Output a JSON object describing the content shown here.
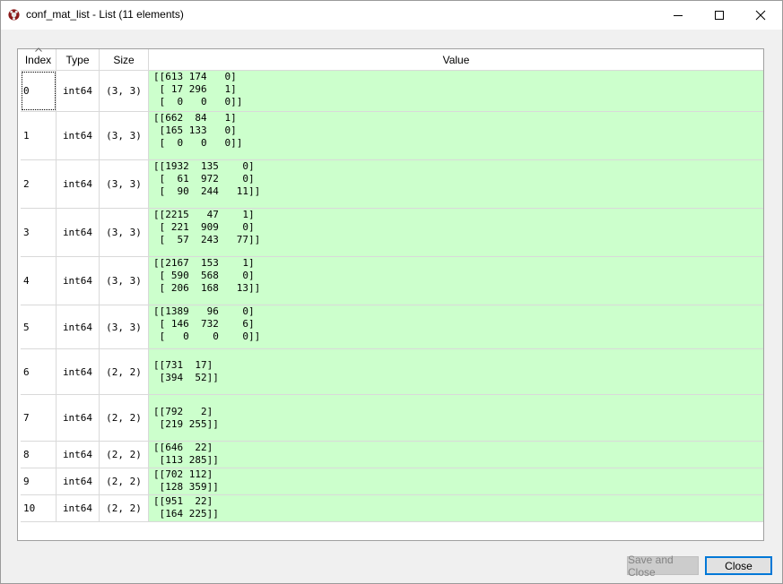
{
  "window": {
    "title": "conf_mat_list - List (11 elements)",
    "icon": "spyder-icon"
  },
  "columns": {
    "index": "Index",
    "type": "Type",
    "size": "Size",
    "value": "Value"
  },
  "rows": [
    {
      "index": "0",
      "type": "int64",
      "size": "(3, 3)",
      "value": "[[613 174   0]\n [ 17 296   1]\n [  0   0   0]]"
    },
    {
      "index": "1",
      "type": "int64",
      "size": "(3, 3)",
      "value": "[[662  84   1]\n [165 133   0]\n [  0   0   0]]"
    },
    {
      "index": "2",
      "type": "int64",
      "size": "(3, 3)",
      "value": "[[1932  135    0]\n [  61  972    0]\n [  90  244   11]]"
    },
    {
      "index": "3",
      "type": "int64",
      "size": "(3, 3)",
      "value": "[[2215   47    1]\n [ 221  909    0]\n [  57  243   77]]"
    },
    {
      "index": "4",
      "type": "int64",
      "size": "(3, 3)",
      "value": "[[2167  153    1]\n [ 590  568    0]\n [ 206  168   13]]"
    },
    {
      "index": "5",
      "type": "int64",
      "size": "(3, 3)",
      "value": "[[1389   96    0]\n [ 146  732    6]\n [   0    0    0]]"
    },
    {
      "index": "6",
      "type": "int64",
      "size": "(2, 2)",
      "value": "[[731  17]\n [394  52]]"
    },
    {
      "index": "7",
      "type": "int64",
      "size": "(2, 2)",
      "value": "[[792   2]\n [219 255]]"
    },
    {
      "index": "8",
      "type": "int64",
      "size": "(2, 2)",
      "value": "[[646  22]\n [113 285]]"
    },
    {
      "index": "9",
      "type": "int64",
      "size": "(2, 2)",
      "value": "[[702 112]\n [128 359]]"
    },
    {
      "index": "10",
      "type": "int64",
      "size": "(2, 2)",
      "value": "[[951  22]\n [164 225]]"
    }
  ],
  "buttons": {
    "save_and_close": "Save and Close",
    "close": "Close"
  },
  "colors": {
    "value_background": "#ccffcc",
    "focus_border": "#0078d7"
  }
}
